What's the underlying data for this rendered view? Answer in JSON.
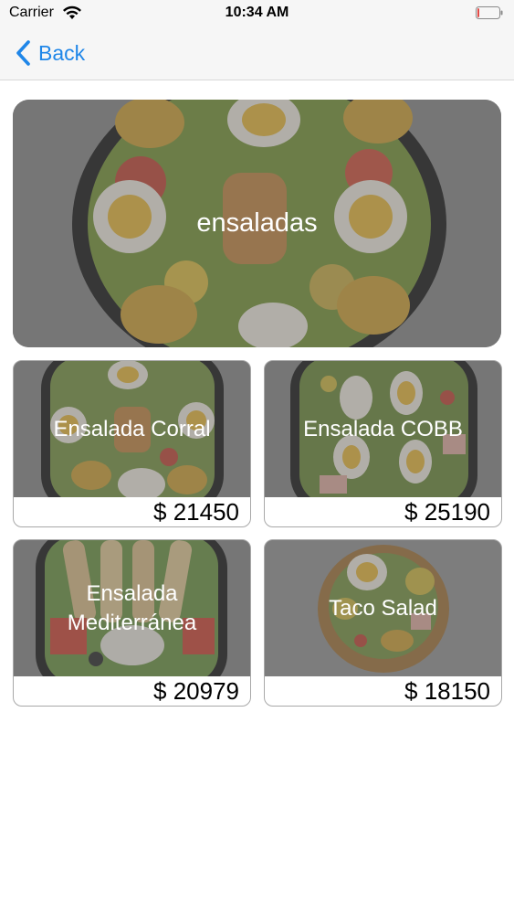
{
  "status_bar": {
    "carrier": "Carrier",
    "time": "10:34 AM",
    "battery_level": 0.08,
    "battery_color": "#e0332e"
  },
  "nav": {
    "back_label": "Back",
    "accent_color": "#1f86e8"
  },
  "category": {
    "title": "ensaladas",
    "image": "salad-bowl"
  },
  "products": [
    {
      "name": "Ensalada Corral",
      "price": "$ 21450",
      "image": "corral-salad"
    },
    {
      "name": "Ensalada COBB",
      "price": "$ 25190",
      "image": "cobb-salad"
    },
    {
      "name": "Ensalada Mediterránea",
      "price": "$ 20979",
      "image": "mediterranean-salad"
    },
    {
      "name": "Taco Salad",
      "price": "$ 18150",
      "image": "taco-salad"
    }
  ]
}
